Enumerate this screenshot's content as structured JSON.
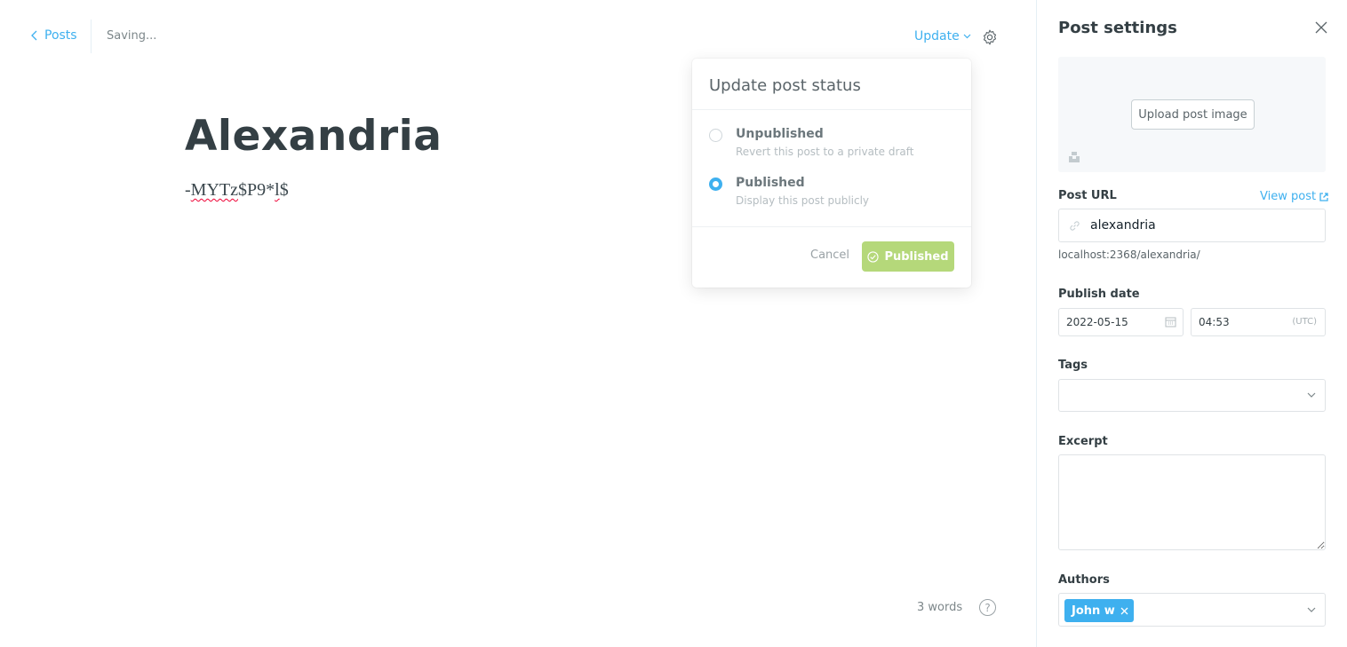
{
  "editor": {
    "back_label": "Posts",
    "save_status": "Saving...",
    "update_label": "Update",
    "title": "Alexandria",
    "body_prefix": "-",
    "body_misspelled": "MYTz",
    "body_middle": "$P9*",
    "body_misspelled2": "l",
    "body_suffix": "$",
    "word_count": "3 words",
    "help_label": "?"
  },
  "status_popover": {
    "heading": "Update post status",
    "options": [
      {
        "label": "Unpublished",
        "description": "Revert this post to a private draft",
        "selected": false
      },
      {
        "label": "Published",
        "description": "Display this post publicly",
        "selected": true
      }
    ],
    "cancel_label": "Cancel",
    "confirm_label": "Published",
    "confirm_color": "#b5d87a"
  },
  "sidebar": {
    "title": "Post settings",
    "upload_label": "Upload post image",
    "post_url_label": "Post URL",
    "view_post_label": "View post",
    "slug": "alexandria",
    "url_preview": "localhost:2368/alexandria/",
    "publish_date_label": "Publish date",
    "date": "2022-05-15",
    "time": "04:53",
    "timezone": "(UTC)",
    "tags_label": "Tags",
    "excerpt_label": "Excerpt",
    "authors_label": "Authors",
    "author": "John w"
  },
  "colors": {
    "accent": "#3eb0ef",
    "published_green": "#b5d87a",
    "title_text": "#343f44"
  },
  "icons": [
    "chevron-left-icon",
    "chevron-down-icon",
    "gear-icon",
    "close-icon",
    "unsplash-icon",
    "external-link-icon",
    "link-icon",
    "calendar-icon",
    "check-circle-icon",
    "help-icon"
  ]
}
